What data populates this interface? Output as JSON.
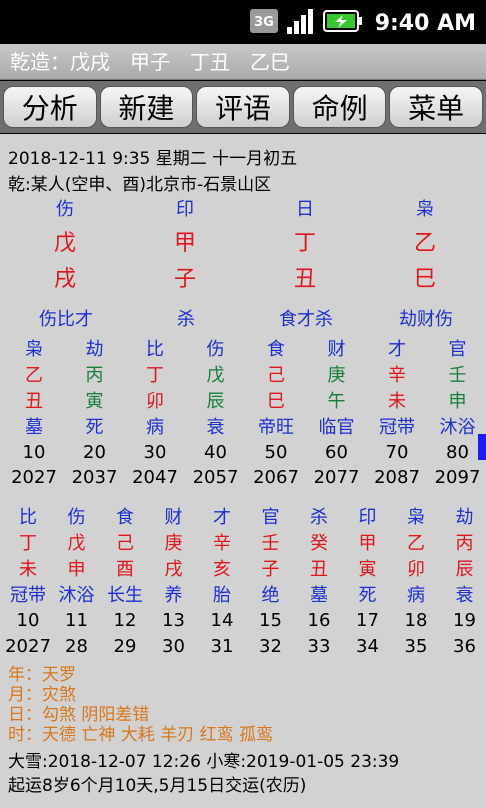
{
  "status_bar": {
    "network": "3G",
    "time": "9:40 AM"
  },
  "header": {
    "gender": "乾造：",
    "pillars": [
      "戊戌",
      "甲子",
      "丁丑",
      "乙巳"
    ]
  },
  "toolbar": [
    "分析",
    "新建",
    "评语",
    "命例",
    "菜单"
  ],
  "info": {
    "date_line": "2018-12-11 9:35  星期二  十一月初五",
    "person_line": "乾:某人(空申、酉)北京市-石景山区"
  },
  "chart": {
    "gods": [
      "伤",
      "印",
      "日",
      "枭"
    ],
    "stems": [
      "戊",
      "甲",
      "丁",
      "乙"
    ],
    "branches": [
      "戌",
      "子",
      "丑",
      "巳"
    ],
    "hidden": [
      "伤比才",
      "杀",
      "食才杀",
      "劫财伤"
    ]
  },
  "dayun": {
    "gods": [
      "枭",
      "劫",
      "比",
      "伤",
      "食",
      "财",
      "才",
      "官"
    ],
    "stems": [
      "乙",
      "丙",
      "丁",
      "戊",
      "己",
      "庚",
      "辛",
      "壬"
    ],
    "branches": [
      "丑",
      "寅",
      "卯",
      "辰",
      "巳",
      "午",
      "未",
      "申"
    ],
    "stages": [
      "墓",
      "死",
      "病",
      "衰",
      "帝旺",
      "临官",
      "冠带",
      "沐浴"
    ],
    "ages": [
      "10",
      "20",
      "30",
      "40",
      "50",
      "60",
      "70",
      "80"
    ],
    "years": [
      "2027",
      "2037",
      "2047",
      "2057",
      "2067",
      "2077",
      "2087",
      "2097"
    ]
  },
  "liunian": {
    "gods": [
      "比",
      "伤",
      "食",
      "财",
      "才",
      "官",
      "杀",
      "印",
      "枭",
      "劫"
    ],
    "stems": [
      "丁",
      "戊",
      "己",
      "庚",
      "辛",
      "壬",
      "癸",
      "甲",
      "乙",
      "丙"
    ],
    "branches": [
      "未",
      "申",
      "酉",
      "戌",
      "亥",
      "子",
      "丑",
      "寅",
      "卯",
      "辰"
    ],
    "stages": [
      "冠带",
      "沐浴",
      "长生",
      "养",
      "胎",
      "绝",
      "墓",
      "死",
      "病",
      "衰"
    ],
    "ages": [
      "10",
      "11",
      "12",
      "13",
      "14",
      "15",
      "16",
      "17",
      "18",
      "19"
    ],
    "years": [
      "2027",
      "28",
      "29",
      "30",
      "31",
      "32",
      "33",
      "34",
      "35",
      "36"
    ]
  },
  "shensha": [
    "年：天罗",
    "月：灾煞",
    "日：勾煞 阴阳差错",
    "时：天德 亡神 大耗 羊刃 红鸾 孤鸾"
  ],
  "footer": {
    "jieqi": "大雪:2018-12-07 12:26  小寒:2019-01-05 23:39",
    "qiyun": "起运8岁6个月10天,5月15日交运(农历)"
  },
  "colors": {
    "blue": "#1d2fd0",
    "red": "#e0141c",
    "green": "#15803a",
    "orange": "#d9771c",
    "scroll": "#1a1aff"
  }
}
